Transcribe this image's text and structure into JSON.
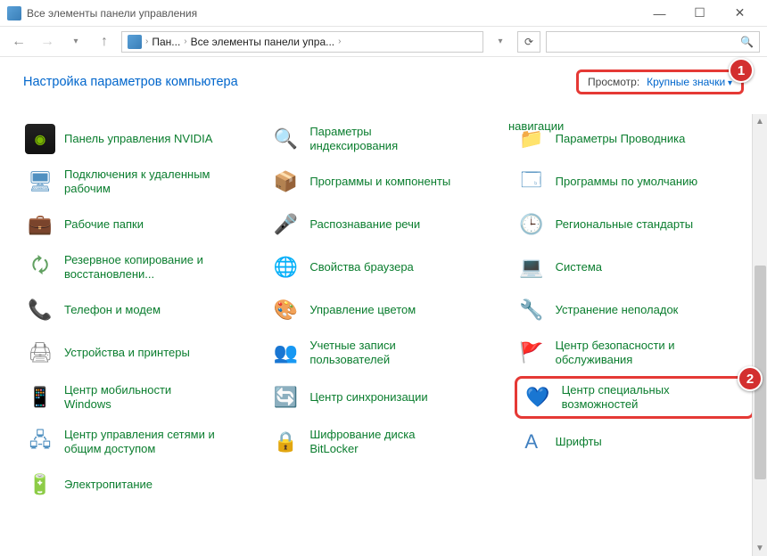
{
  "window": {
    "title": "Все элементы панели управления"
  },
  "breadcrumb": {
    "part1": "Пан...",
    "part2": "Все элементы панели упра..."
  },
  "header": {
    "title": "Настройка параметров компьютера",
    "view_label": "Просмотр:",
    "view_value": "Крупные значки"
  },
  "truncated_top": "навигации",
  "items": [
    [
      {
        "label": "Панель управления NVIDIA",
        "icon": "i-nvidia",
        "name": "nvidia-control-panel"
      },
      {
        "label": "Параметры индексирования",
        "icon": "i-index",
        "name": "indexing-options"
      },
      {
        "label": "Параметры Проводника",
        "icon": "i-explorer",
        "name": "explorer-options"
      }
    ],
    [
      {
        "label": "Подключения к удаленным рабочим",
        "icon": "i-remote",
        "name": "remote-desktop"
      },
      {
        "label": "Программы и компоненты",
        "icon": "i-programs",
        "name": "programs-and-features"
      },
      {
        "label": "Программы по умолчанию",
        "icon": "i-default",
        "name": "default-programs"
      }
    ],
    [
      {
        "label": "Рабочие папки",
        "icon": "i-folders",
        "name": "work-folders"
      },
      {
        "label": "Распознавание речи",
        "icon": "i-speech",
        "name": "speech-recognition"
      },
      {
        "label": "Региональные стандарты",
        "icon": "i-region",
        "name": "regional-settings"
      }
    ],
    [
      {
        "label": "Резервное копирование и восстановлени...",
        "icon": "i-backup",
        "name": "backup-restore"
      },
      {
        "label": "Свойства браузера",
        "icon": "i-browser",
        "name": "internet-options"
      },
      {
        "label": "Система",
        "icon": "i-system",
        "name": "system"
      }
    ],
    [
      {
        "label": "Телефон и модем",
        "icon": "i-phone",
        "name": "phone-modem"
      },
      {
        "label": "Управление цветом",
        "icon": "i-color",
        "name": "color-management"
      },
      {
        "label": "Устранение неполадок",
        "icon": "i-trouble",
        "name": "troubleshooting"
      }
    ],
    [
      {
        "label": "Устройства и принтеры",
        "icon": "i-devices",
        "name": "devices-printers"
      },
      {
        "label": "Учетные записи пользователей",
        "icon": "i-users",
        "name": "user-accounts"
      },
      {
        "label": "Центр безопасности и обслуживания",
        "icon": "i-security",
        "name": "security-maintenance"
      }
    ],
    [
      {
        "label": "Центр мобильности Windows",
        "icon": "i-mobility",
        "name": "mobility-center"
      },
      {
        "label": "Центр синхронизации",
        "icon": "i-sync",
        "name": "sync-center"
      },
      {
        "label": "Центр специальных возможностей",
        "icon": "i-ease",
        "name": "ease-of-access",
        "highlight": true
      }
    ],
    [
      {
        "label": "Центр управления сетями и общим доступом",
        "icon": "i-network",
        "name": "network-sharing"
      },
      {
        "label": "Шифрование диска BitLocker",
        "icon": "i-bitlocker",
        "name": "bitlocker"
      },
      {
        "label": "Шрифты",
        "icon": "i-fonts",
        "name": "fonts"
      }
    ],
    [
      {
        "label": "Электропитание",
        "icon": "i-power",
        "name": "power-options"
      }
    ]
  ],
  "icon_glyphs": {
    "i-nvidia": "◉",
    "i-index": "🔍",
    "i-explorer": "📁",
    "i-remote": "🖥",
    "i-programs": "📦",
    "i-default": "🗔",
    "i-folders": "💼",
    "i-speech": "🎤",
    "i-region": "🕒",
    "i-backup": "🗘",
    "i-browser": "🌐",
    "i-system": "💻",
    "i-phone": "📞",
    "i-color": "🎨",
    "i-trouble": "🔧",
    "i-devices": "🖨",
    "i-users": "👥",
    "i-security": "🚩",
    "i-mobility": "📱",
    "i-sync": "🔄",
    "i-ease": "💙",
    "i-network": "🖧",
    "i-bitlocker": "🔒",
    "i-fonts": "A",
    "i-power": "🔋"
  },
  "badges": {
    "one": "1",
    "two": "2"
  }
}
